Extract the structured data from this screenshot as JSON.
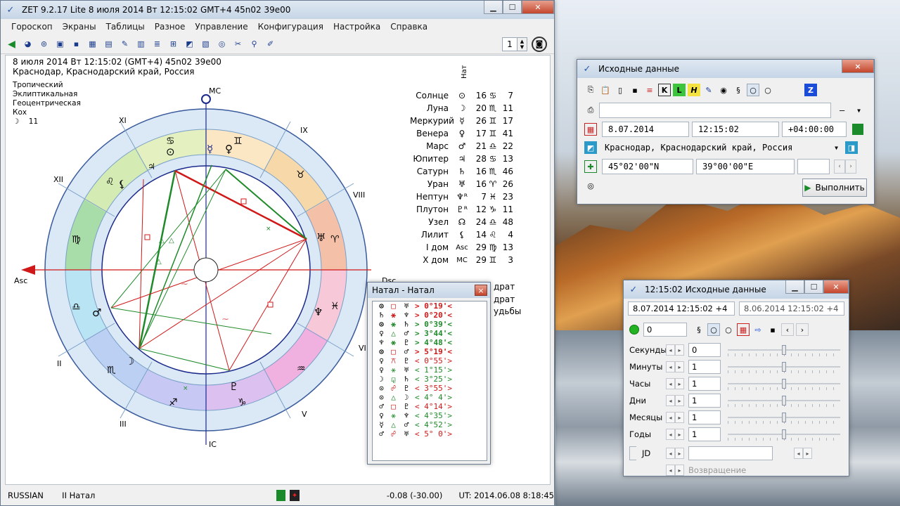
{
  "main": {
    "title": "ZET 9.2.17 Lite     8 июля 2014   Вт   12:15:02 GMT+4 45n02  39e00",
    "menu": [
      "Гороскоп",
      "Экраны",
      "Таблицы",
      "Разное",
      "Управление",
      "Конфигурация",
      "Настройка",
      "Справка"
    ],
    "spin_value": "1",
    "info_line1": "8 июля 2014   Вт   12:15:02 (GMT+4) 45n02  39e00",
    "info_line2": "Краснодар, Краснодарский край, Россия",
    "settings": [
      "Тропический",
      "Эклиптикальная",
      "Геоцентрическая",
      "Кох"
    ],
    "moon_day_glyph": "☽",
    "moon_day": "11",
    "nat_header": "Нат",
    "planets": [
      {
        "name": "Солнце",
        "glyph": "⊙",
        "deg": "16",
        "sign": "♋",
        "min": "7"
      },
      {
        "name": "Луна",
        "glyph": "☽",
        "deg": "20",
        "sign": "♏",
        "min": "11"
      },
      {
        "name": "Меркурий",
        "glyph": "☿",
        "deg": "26",
        "sign": "♊",
        "min": "17"
      },
      {
        "name": "Венера",
        "glyph": "♀",
        "deg": "17",
        "sign": "♊",
        "min": "41"
      },
      {
        "name": "Марс",
        "glyph": "♂",
        "deg": "21",
        "sign": "♎",
        "min": "22"
      },
      {
        "name": "Юпитер",
        "glyph": "♃",
        "deg": "28",
        "sign": "♋",
        "min": "13"
      },
      {
        "name": "Сатурн",
        "glyph": "♄",
        "deg": "16",
        "sign": "♏",
        "min": "46"
      },
      {
        "name": "Уран",
        "glyph": "♅",
        "deg": "16",
        "sign": "♈",
        "min": "26"
      },
      {
        "name": "Нептун",
        "glyph": "♆ᴿ",
        "deg": "7",
        "sign": "♓",
        "min": "23"
      },
      {
        "name": "Плутон",
        "glyph": "♇ᴿ",
        "deg": "12",
        "sign": "♑",
        "min": "11"
      },
      {
        "name": "Узел",
        "glyph": "☊",
        "deg": "24",
        "sign": "♎",
        "min": "48"
      },
      {
        "name": "Лилит",
        "glyph": "⚸",
        "deg": "14",
        "sign": "♌",
        "min": "4"
      },
      {
        "name": "I дом",
        "glyph": "Asc",
        "deg": "29",
        "sign": "♍",
        "min": "13"
      },
      {
        "name": "X дом",
        "glyph": "MC",
        "deg": "29",
        "sign": "♊",
        "min": "3"
      }
    ],
    "partial_right": [
      "драт",
      "драт",
      "удьбы"
    ],
    "wheel_labels": {
      "mc": "MC",
      "ic": "IC",
      "asc": "Asc",
      "dsc": "Dsc",
      "houses": [
        "XI",
        "IX",
        "XII",
        "VIII",
        "II",
        "VI",
        "III",
        "V"
      ]
    },
    "status": {
      "language": "RUSSIAN",
      "mode": "II Натал",
      "offset": "-0.08 (-30.00)",
      "ut": "UT: 2014.06.08  8:18:45"
    }
  },
  "natal": {
    "title": "Натал - Натал",
    "close": "×",
    "rows": [
      {
        "p1": "⊙",
        "asp": "□",
        "p2": "♅",
        "val": ">  0°19'<",
        "color": "#d01818",
        "bold": true
      },
      {
        "p1": "♄",
        "asp": "⚹",
        "p2": "♆",
        "val": ">  0°20'<",
        "color": "#d01818",
        "bold": true
      },
      {
        "p1": "⊙",
        "asp": "⚹",
        "p2": "♄",
        "val": ">  0°39'<",
        "color": "#1f8a2a",
        "bold": true
      },
      {
        "p1": "♀",
        "asp": "△",
        "p2": "♂",
        "val": ">  3°44'<",
        "color": "#1f8a2a",
        "bold": true
      },
      {
        "p1": "♆",
        "asp": "⚹",
        "p2": "♇",
        "val": ">  4°48'<",
        "color": "#1f8a2a",
        "bold": true
      },
      {
        "p1": "⊙",
        "asp": "□",
        "p2": "♂",
        "val": ">  5°19'<",
        "color": "#d01818",
        "bold": true
      },
      {
        "p1": "♀",
        "asp": "⚻",
        "p2": "♇",
        "val": "<  0°55'>",
        "color": "#d01818",
        "bold": false
      },
      {
        "p1": "♀",
        "asp": "⚹",
        "p2": "♅",
        "val": "<  1°15'>",
        "color": "#1f8a2a",
        "bold": false
      },
      {
        "p1": "☽",
        "asp": "⚼",
        "p2": "♄",
        "val": "<  3°25'>",
        "color": "#1f8a2a",
        "bold": false
      },
      {
        "p1": "⊙",
        "asp": "☍",
        "p2": "♇",
        "val": "<  3°55'>",
        "color": "#d01818",
        "bold": false
      },
      {
        "p1": "⊙",
        "asp": "△",
        "p2": "☽",
        "val": "<  4° 4'>",
        "color": "#1f8a2a",
        "bold": false
      },
      {
        "p1": "♂",
        "asp": "□",
        "p2": "♇",
        "val": "<  4°14'>",
        "color": "#d01818",
        "bold": false
      },
      {
        "p1": "♀",
        "asp": "⚹",
        "p2": "♆",
        "val": "<  4°35'>",
        "color": "#1f8a2a",
        "bold": false
      },
      {
        "p1": "☿",
        "asp": "△",
        "p2": "♂",
        "val": "<  4°52'>",
        "color": "#1f8a2a",
        "bold": false
      },
      {
        "p1": "♂",
        "asp": "☍",
        "p2": "♅",
        "val": "<  5° 0'>",
        "color": "#d01818",
        "bold": false
      }
    ]
  },
  "source": {
    "title": "Исходные данные",
    "close": "×",
    "name_value": "",
    "gender_value": "–",
    "date": "8.07.2014",
    "time": "12:15:02",
    "tz": "+04:00:00",
    "place": "Краснодар, Краснодарский край, Россия",
    "lat": "45°02'00\"N",
    "lon": "39°00'00\"E",
    "extra": "",
    "run_label": "Выполнить"
  },
  "timewin": {
    "title": "12:15:02 Исходные данные",
    "field1": "8.07.2014  12:15:02  +4",
    "field2": "8.06.2014  12:15:02  +4",
    "counter": "0",
    "rows": [
      {
        "label": "Секунды",
        "value": "0",
        "level": 0.5
      },
      {
        "label": "Минуты",
        "value": "1",
        "level": 0.5
      },
      {
        "label": "Часы",
        "value": "1",
        "level": 0.5
      },
      {
        "label": "Дни",
        "value": "1",
        "level": 0.5
      },
      {
        "label": "Месяцы",
        "value": "1",
        "level": 0.5
      },
      {
        "label": "Годы",
        "value": "1",
        "level": 0.5
      }
    ],
    "jd_label": "JD",
    "jd_value": "",
    "return_label": "Возвращение"
  },
  "colors": {
    "accent_red": "#d01818",
    "accent_green": "#1f8a2a",
    "wheel_blue": "#1a2a8a"
  }
}
